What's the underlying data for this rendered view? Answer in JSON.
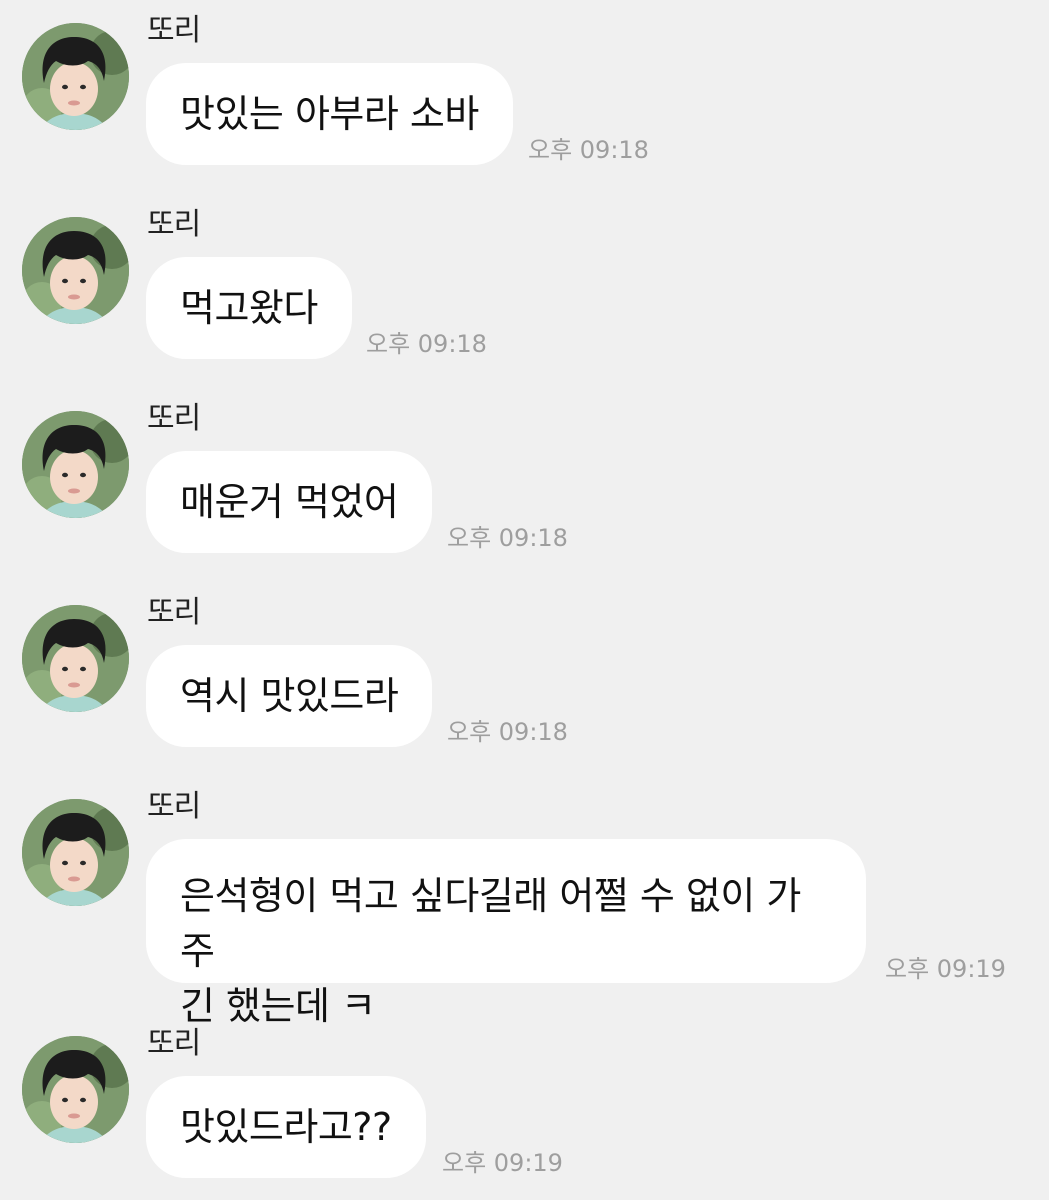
{
  "messages": [
    {
      "sender": "또리",
      "text": "맛있는 아부라 소바",
      "time": "오후 09:18",
      "avatar_icon": "child-portrait-avatar"
    },
    {
      "sender": "또리",
      "text": "먹고왔다",
      "time": "오후 09:18",
      "avatar_icon": "child-portrait-avatar"
    },
    {
      "sender": "또리",
      "text": "매운거 먹었어",
      "time": "오후 09:18",
      "avatar_icon": "child-portrait-avatar"
    },
    {
      "sender": "또리",
      "text": "역시 맛있드라",
      "time": "오후 09:18",
      "avatar_icon": "child-portrait-avatar"
    },
    {
      "sender": "또리",
      "text_line1": "은석형이 먹고 싶다길래 어쩔 수 없이 가주",
      "text_line2": "긴 했는데 ㅋ",
      "time": "오후 09:19",
      "avatar_icon": "child-portrait-avatar"
    },
    {
      "sender": "또리",
      "text": "맛있드라고??",
      "time": "오후 09:19",
      "avatar_icon": "child-portrait-avatar"
    }
  ],
  "colors": {
    "background": "#f0f0f0",
    "bubble": "#ffffff",
    "time_text": "#9e9e9e",
    "message_text": "#111111"
  }
}
